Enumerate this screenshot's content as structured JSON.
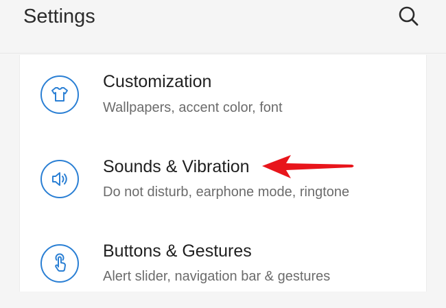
{
  "header": {
    "title": "Settings",
    "search_icon": "search-icon"
  },
  "settings": {
    "items": [
      {
        "title": "Customization",
        "subtitle": "Wallpapers, accent color, font",
        "icon": "tshirt-icon"
      },
      {
        "title": "Sounds & Vibration",
        "subtitle": "Do not disturb, earphone mode, ringtone",
        "icon": "speaker-icon"
      },
      {
        "title": "Buttons & Gestures",
        "subtitle": "Alert slider, navigation bar & gestures",
        "icon": "tap-gesture-icon"
      }
    ]
  },
  "annotation": {
    "arrow_color": "#e8151b",
    "points_to": "Sounds & Vibration"
  },
  "colors": {
    "accent": "#2a7fd4",
    "background": "#f5f5f5",
    "card": "#ffffff"
  }
}
